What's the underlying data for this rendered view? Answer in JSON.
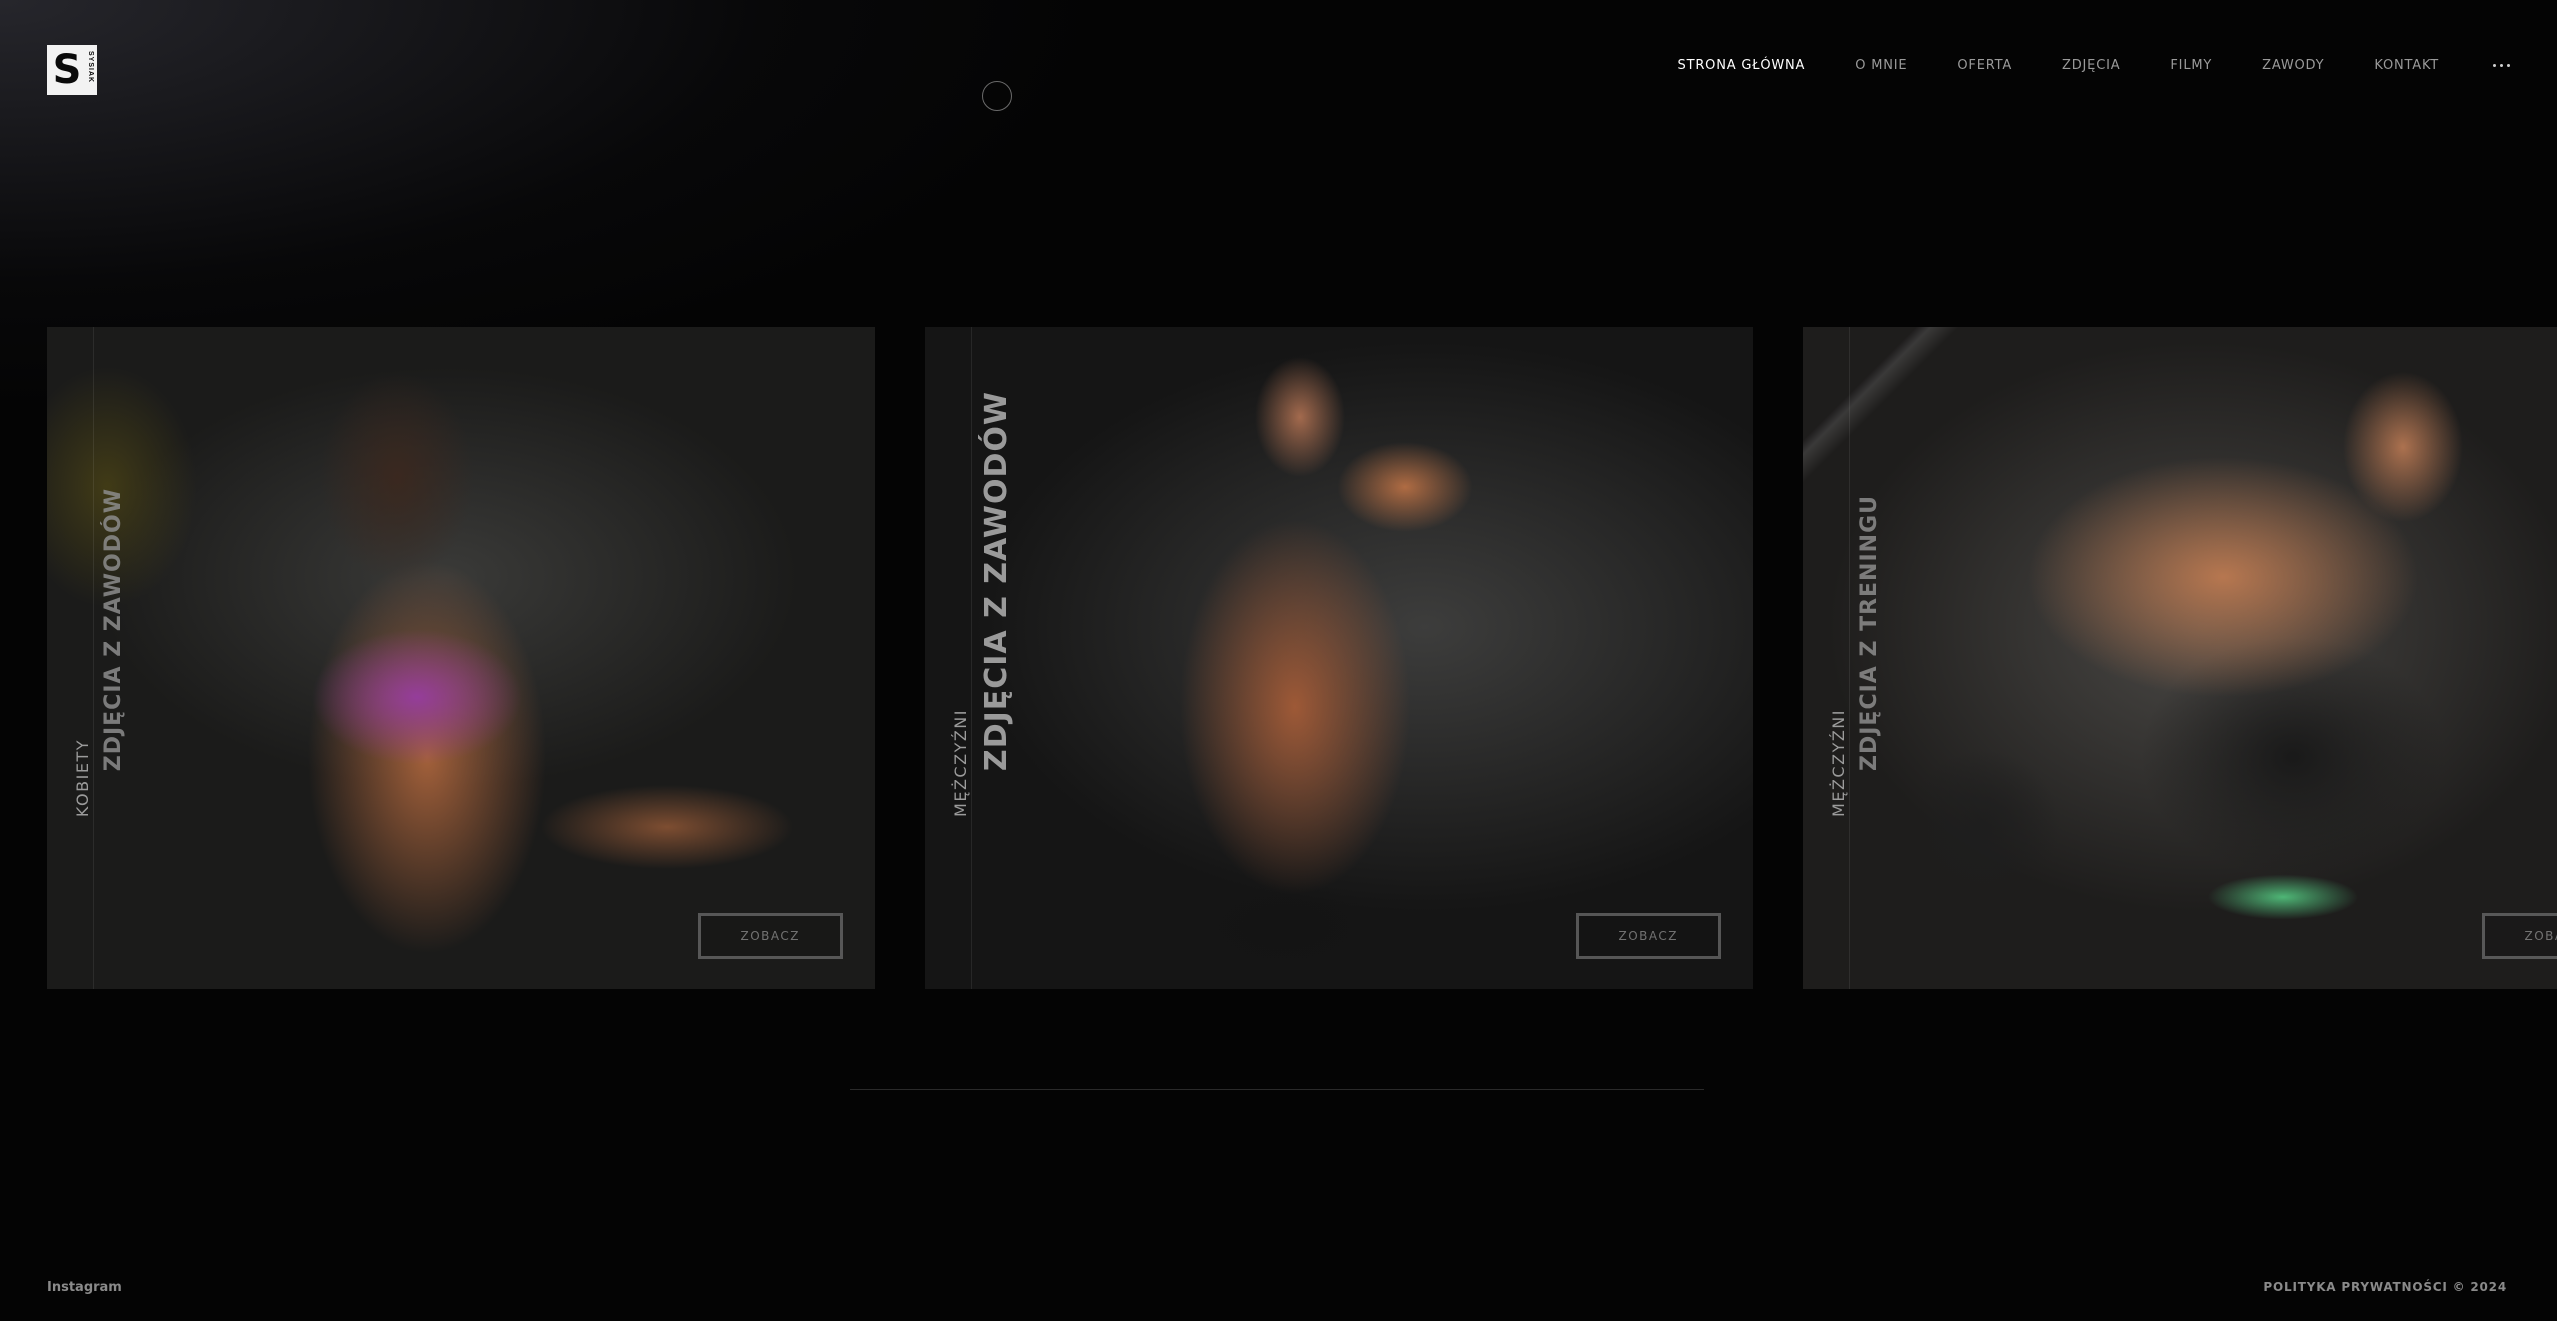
{
  "header": {
    "logo": {
      "letter": "S",
      "subtext": "SYSIAK"
    },
    "nav": [
      {
        "label": "STRONA GŁÓWNA",
        "active": true
      },
      {
        "label": "O MNIE"
      },
      {
        "label": "OFERTA"
      },
      {
        "label": "ZDJĘCIA"
      },
      {
        "label": "FILMY"
      },
      {
        "label": "ZAWODY"
      },
      {
        "label": "KONTAKT"
      }
    ],
    "more_icon": "ellipsis-icon"
  },
  "gallery": {
    "cards": [
      {
        "category": "KOBIETY",
        "title": "ZDJĘCIA Z ZAWODÓW",
        "button": "ZOBACZ"
      },
      {
        "category": "MĘŻCZYŹNI",
        "title": "ZDJĘCIA Z ZAWODÓW",
        "button": "ZOBACZ"
      },
      {
        "category": "MĘŻCZYŹNI",
        "title": "ZDJĘCIA Z TRENINGU",
        "button": "ZOBACZ"
      }
    ]
  },
  "footer": {
    "left_link": "Instagram",
    "right_text": "POLITYKA PRYWATNOŚCI © 2024"
  },
  "colors": {
    "background": "#040404",
    "nav_active": "#ffffff",
    "nav_inactive": "#9a9a9a"
  }
}
